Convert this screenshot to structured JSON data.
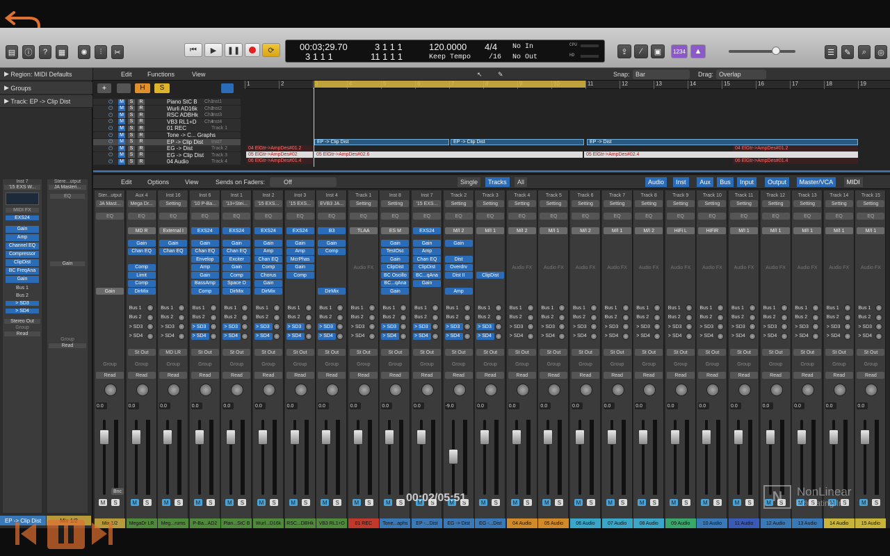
{
  "transport": {
    "time": "00:03;29.70",
    "bars": "3 1 1 1",
    "bars_sub": "3 1 1 1",
    "bars2": "11 1 1 1",
    "tempo": "120.0000",
    "tempo_mode": "Keep Tempo",
    "sig": "4/4",
    "div": "/16",
    "in": "No In",
    "out": "No Out",
    "cpu": "CPU",
    "hd": "HD",
    "count": "1234"
  },
  "inspector": {
    "region": "Region: MIDI Defaults",
    "groups": "Groups",
    "track": "Track: EP -> Clip Dist",
    "inst_label": "Inst 7",
    "inst_name": "'15 EXS W...",
    "stereo_label": "Stere...utput",
    "stereo_name": "JA Masteri...",
    "eq": "EQ",
    "midifx": "MIDI FX",
    "exs24": "EXS24",
    "plugins": [
      "Gain",
      "Amp",
      "Channel EQ",
      "Compressor",
      "ClipDist",
      "BC FreqAna",
      "Gain"
    ],
    "gain2": "Gain",
    "sends": [
      "Bus 1",
      "Bus 2",
      "> SD3",
      "> SD4"
    ],
    "stereo_out": "Stereo Out",
    "group": "Group",
    "read": "Read",
    "val": "0.0",
    "m": "M",
    "s": "S",
    "bnc": "Bnce",
    "name1": "EP -> Clip Dist",
    "name2": "Mix 1/2"
  },
  "arrange": {
    "edit": "Edit",
    "functions": "Functions",
    "view": "View",
    "snap_label": "Snap:",
    "snap_val": "Bar",
    "drag_label": "Drag:",
    "drag_val": "Overlap",
    "h": "H",
    "s": "S",
    "ruler": [
      "1",
      "2",
      "3",
      "4",
      "5",
      "6",
      "7",
      "8",
      "9",
      "10",
      "11",
      "12",
      "13",
      "14",
      "15",
      "16",
      "17",
      "18",
      "19"
    ],
    "tracks": [
      {
        "name": "Piano StC B",
        "sub": "Ch1",
        "num": "Inst1"
      },
      {
        "name": "Wurli AD16k",
        "sub": "Ch2",
        "num": "Inst2"
      },
      {
        "name": "RSC ADBHk",
        "sub": "Ch3",
        "num": "Inst3"
      },
      {
        "name": "VB3 RL1+D",
        "sub": "Ch4",
        "num": "Inst4"
      },
      {
        "name": "01 REC",
        "sub": "",
        "num": "Track 1"
      },
      {
        "name": "Tone -> C... Graphs",
        "sub": "",
        "num": ""
      },
      {
        "name": "EP -> Clip Dist",
        "sub": "",
        "num": "Inst7"
      },
      {
        "name": "EG -> Dist",
        "sub": "",
        "num": "Track 2"
      },
      {
        "name": "EG -> Clip Dist",
        "sub": "",
        "num": "Track 3"
      },
      {
        "name": "04 Audio",
        "sub": "",
        "num": "Track 4"
      }
    ],
    "regions": {
      "ep1": "EP -> Clip Dist",
      "ep2": "EP -> Clip Dist",
      "ep3": "EP -> Dist",
      "a1": "04 ElGtr->AmpDes#01.2",
      "a2": "04 ElGtr->AmpDes#01.2",
      "b1": "05 ElGtr->AmpDes#02",
      "b2": "05 ElGtr->AmpDes#02.6",
      "b3": "05 ElGtr->AmpDes#02.4",
      "c1": "06 ElGtr->AmpDes#01.4",
      "c2": "06 ElGtr->AmpDes#01.4"
    }
  },
  "mixer_bar": {
    "edit": "Edit",
    "options": "Options",
    "view": "View",
    "sends_on": "Sends on Faders:",
    "off": "Off",
    "single": "Single",
    "tracks": "Tracks",
    "all": "All",
    "filters": [
      "Audio",
      "Inst",
      "Aux",
      "Bus",
      "Input",
      "Output",
      "Master/VCA",
      "MIDI"
    ]
  },
  "strips": [
    {
      "label": "Ster...utput",
      "setting": "JA Mast...",
      "in": "",
      "plugins": [],
      "gain": "Gain",
      "out": "",
      "name": "Mix 1/2",
      "color": "#b79a3c",
      "val": "0.0",
      "bnc": "Bnc"
    },
    {
      "label": "Aux 4",
      "setting": "Mega Dr...",
      "in": "MD R",
      "plugins": [
        "Gain",
        "Chan EQ",
        "",
        "Comp",
        "Limit",
        "Comp",
        "DirMix"
      ],
      "out": "St Out",
      "name": "MegaDr LR",
      "color": "#4f8a3a",
      "val": "0.0"
    },
    {
      "label": "Inst 16",
      "setting": "Setting",
      "in": "External I",
      "plugins": [
        "Gain",
        "Chan EQ"
      ],
      "out": "MD LR",
      "name": "Meg...rums",
      "color": "#4f8a3a",
      "val": "0.0"
    },
    {
      "label": "Inst 6",
      "setting": "'10 P-Ba...",
      "in": "EXS24",
      "plugins": [
        "Gain",
        "Chan EQ",
        "Envelop",
        "Amp",
        "Gain",
        "BassAmp",
        "Comp"
      ],
      "out": "St Out",
      "name": "P-Ba...AD2",
      "color": "#4f8a3a",
      "val": "0.0"
    },
    {
      "label": "Inst 1",
      "setting": "'13+Stei...",
      "in": "EXS24",
      "plugins": [
        "Gain",
        "Chan EQ",
        "Exciter",
        "Gain",
        "Comp",
        "Space D",
        "DirMix"
      ],
      "out": "St Out",
      "name": "Plan...StC B",
      "color": "#4f8a3a",
      "val": "0.0"
    },
    {
      "label": "Inst 2",
      "setting": "'15 EXS...",
      "in": "EXS24",
      "plugins": [
        "Gain",
        "Amp",
        "Chan EQ",
        "Comp",
        "Chorus",
        "Gain",
        "DirMix"
      ],
      "out": "St Out",
      "name": "Wurl...D16k",
      "color": "#4f8a3a",
      "val": "0.0"
    },
    {
      "label": "Inst 3",
      "setting": "'15 EXS...",
      "in": "EXS24",
      "plugins": [
        "Gain",
        "Amp",
        "McrPhas",
        "Gain",
        "Comp"
      ],
      "out": "St Out",
      "name": "RSC...DBHk",
      "color": "#4f8a3a",
      "val": "0.0"
    },
    {
      "label": "Inst 4",
      "setting": "EVB3 JA...",
      "in": "B3",
      "plugins": [
        "Gain",
        "Comp",
        "",
        "",
        "",
        "",
        "DirMix"
      ],
      "out": "St Out",
      "name": "VB3 RL1+D",
      "color": "#4f8a3a",
      "val": "0.0"
    },
    {
      "label": "Track 1",
      "setting": "Setting",
      "in": "TLAA",
      "plugins": [],
      "out": "St Out",
      "name": "01 REC",
      "color": "#c0392b",
      "val": "0.0"
    },
    {
      "label": "Inst 8",
      "setting": "Setting",
      "in": "ES M",
      "plugins": [
        "Gain",
        "TestOsc",
        "Gain",
        "ClipDist",
        "BC Oscillo",
        "BC...qAna",
        "Gain"
      ],
      "out": "St Out",
      "name": "Tone...aphs",
      "color": "#3a79b8",
      "val": "0.0"
    },
    {
      "label": "Inst 7",
      "setting": "'15 EXS...",
      "in": "EXS24",
      "plugins": [
        "Gain",
        "Amp",
        "Chan EQ",
        "ClipDist",
        "BC...qAna",
        "Gain"
      ],
      "out": "St Out",
      "name": "EP -...Dist",
      "color": "#3a79b8",
      "val": "0.0"
    },
    {
      "label": "Track 2",
      "setting": "Setting",
      "in": "M/I 2",
      "plugins": [
        "Gain",
        "",
        "Dist",
        "Overdrv",
        "Dist II",
        "",
        "Amp"
      ],
      "out": "St Out",
      "name": "EG -> Dist",
      "color": "#3a79b8",
      "val": "-9.0"
    },
    {
      "label": "Track 3",
      "setting": "Setting",
      "in": "M/I 1",
      "plugins": [
        "",
        "",
        "",
        "",
        "ClipDist"
      ],
      "out": "St Out",
      "name": "EG -...Dist",
      "color": "#3a79b8",
      "val": "0.0"
    },
    {
      "label": "Track 4",
      "setting": "Setting",
      "in": "M/I 2",
      "plugins": [],
      "out": "St Out",
      "name": "04 Audio",
      "color": "#d08a2a",
      "val": "0.0"
    },
    {
      "label": "Track 5",
      "setting": "Setting",
      "in": "M/I 1",
      "plugins": [],
      "out": "St Out",
      "name": "05 Audio",
      "color": "#d08a2a",
      "val": "0.0"
    },
    {
      "label": "Track 6",
      "setting": "Setting",
      "in": "M/I 2",
      "plugins": [],
      "out": "St Out",
      "name": "06 Audio",
      "color": "#3aa6c8",
      "val": "0.0"
    },
    {
      "label": "Track 7",
      "setting": "Setting",
      "in": "M/I 1",
      "plugins": [],
      "out": "St Out",
      "name": "07 Audio",
      "color": "#3aa6c8",
      "val": "0.0"
    },
    {
      "label": "Track 8",
      "setting": "Setting",
      "in": "M/I 2",
      "plugins": [],
      "out": "St Out",
      "name": "08 Audio",
      "color": "#3aa6c8",
      "val": "0.0"
    },
    {
      "label": "Track 9",
      "setting": "Setting",
      "in": "HiFi L",
      "plugins": [],
      "out": "St Out",
      "name": "09 Audio",
      "color": "#3aa66a",
      "val": "0.0"
    },
    {
      "label": "Track 10",
      "setting": "Setting",
      "in": "HiFiR",
      "plugins": [],
      "out": "St Out",
      "name": "10 Audio",
      "color": "#3a79b8",
      "val": "0.0"
    },
    {
      "label": "Track 11",
      "setting": "Setting",
      "in": "M/I 1",
      "plugins": [],
      "out": "St Out",
      "name": "11 Audio",
      "color": "#3a5ab8",
      "val": "0.0"
    },
    {
      "label": "Track 12",
      "setting": "Setting",
      "in": "M/I 1",
      "plugins": [],
      "out": "St Out",
      "name": "12 Audio",
      "color": "#3a79b8",
      "val": "0.0"
    },
    {
      "label": "Track 13",
      "setting": "Setting",
      "in": "M/I 1",
      "plugins": [],
      "out": "St Out",
      "name": "13 Audio",
      "color": "#3a79b8",
      "val": "0.0"
    },
    {
      "label": "Track 14",
      "setting": "Setting",
      "in": "M/I 1",
      "plugins": [],
      "out": "St Out",
      "name": "14 Audio",
      "color": "#c8b43a",
      "val": "0.0"
    },
    {
      "label": "Track 15",
      "setting": "Setting",
      "in": "M/I 1",
      "plugins": [],
      "out": "St Out",
      "name": "15 Audio",
      "color": "#c8b43a",
      "val": "0.0"
    }
  ],
  "strip_common": {
    "eq": "EQ",
    "audiofx": "Audio FX",
    "sends": [
      "Bus 1",
      "Bus 2",
      "> SD3",
      "> SD4"
    ],
    "group": "Group",
    "read": "Read",
    "m": "M",
    "s": "S",
    "i": "I",
    "r": "R"
  },
  "overlay": {
    "timecode": "00:02/05:51",
    "brand1": "NonLinear",
    "brand2": "Educating Inc."
  },
  "colors": {
    "accent_blue": "#2b6cb8",
    "record_red": "#e02020",
    "cycle_yellow": "#e8b51c",
    "ruler_yellow": "#d9b740"
  }
}
